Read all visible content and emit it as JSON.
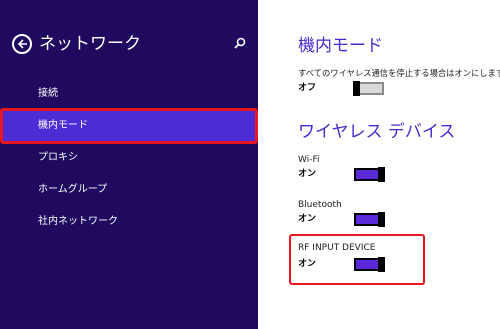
{
  "nav": {
    "title": "ネットワーク",
    "items": [
      {
        "label": "接続"
      },
      {
        "label": "機内モード",
        "selected": true
      },
      {
        "label": "プロキシ"
      },
      {
        "label": "ホームグループ"
      },
      {
        "label": "社内ネットワーク"
      }
    ]
  },
  "airplane": {
    "title": "機内モード",
    "description": "すべてのワイヤレス通信を停止する場合はオンにします",
    "state": "オフ"
  },
  "wireless": {
    "title": "ワイヤレス デバイス",
    "devices": [
      {
        "name": "Wi-Fi",
        "state": "オン"
      },
      {
        "name": "Bluetooth",
        "state": "オン"
      },
      {
        "name": "RF INPUT DEVICE",
        "state": "オン"
      }
    ]
  },
  "colors": {
    "nav_background": "#1f0a60",
    "selected_item": "#4d2cd6",
    "accent": "#4a2ad0",
    "toggle_on": "#5b2ad8",
    "highlight": "#e8161e"
  },
  "icons": {
    "back": "back-arrow-icon",
    "search": "search-icon"
  }
}
